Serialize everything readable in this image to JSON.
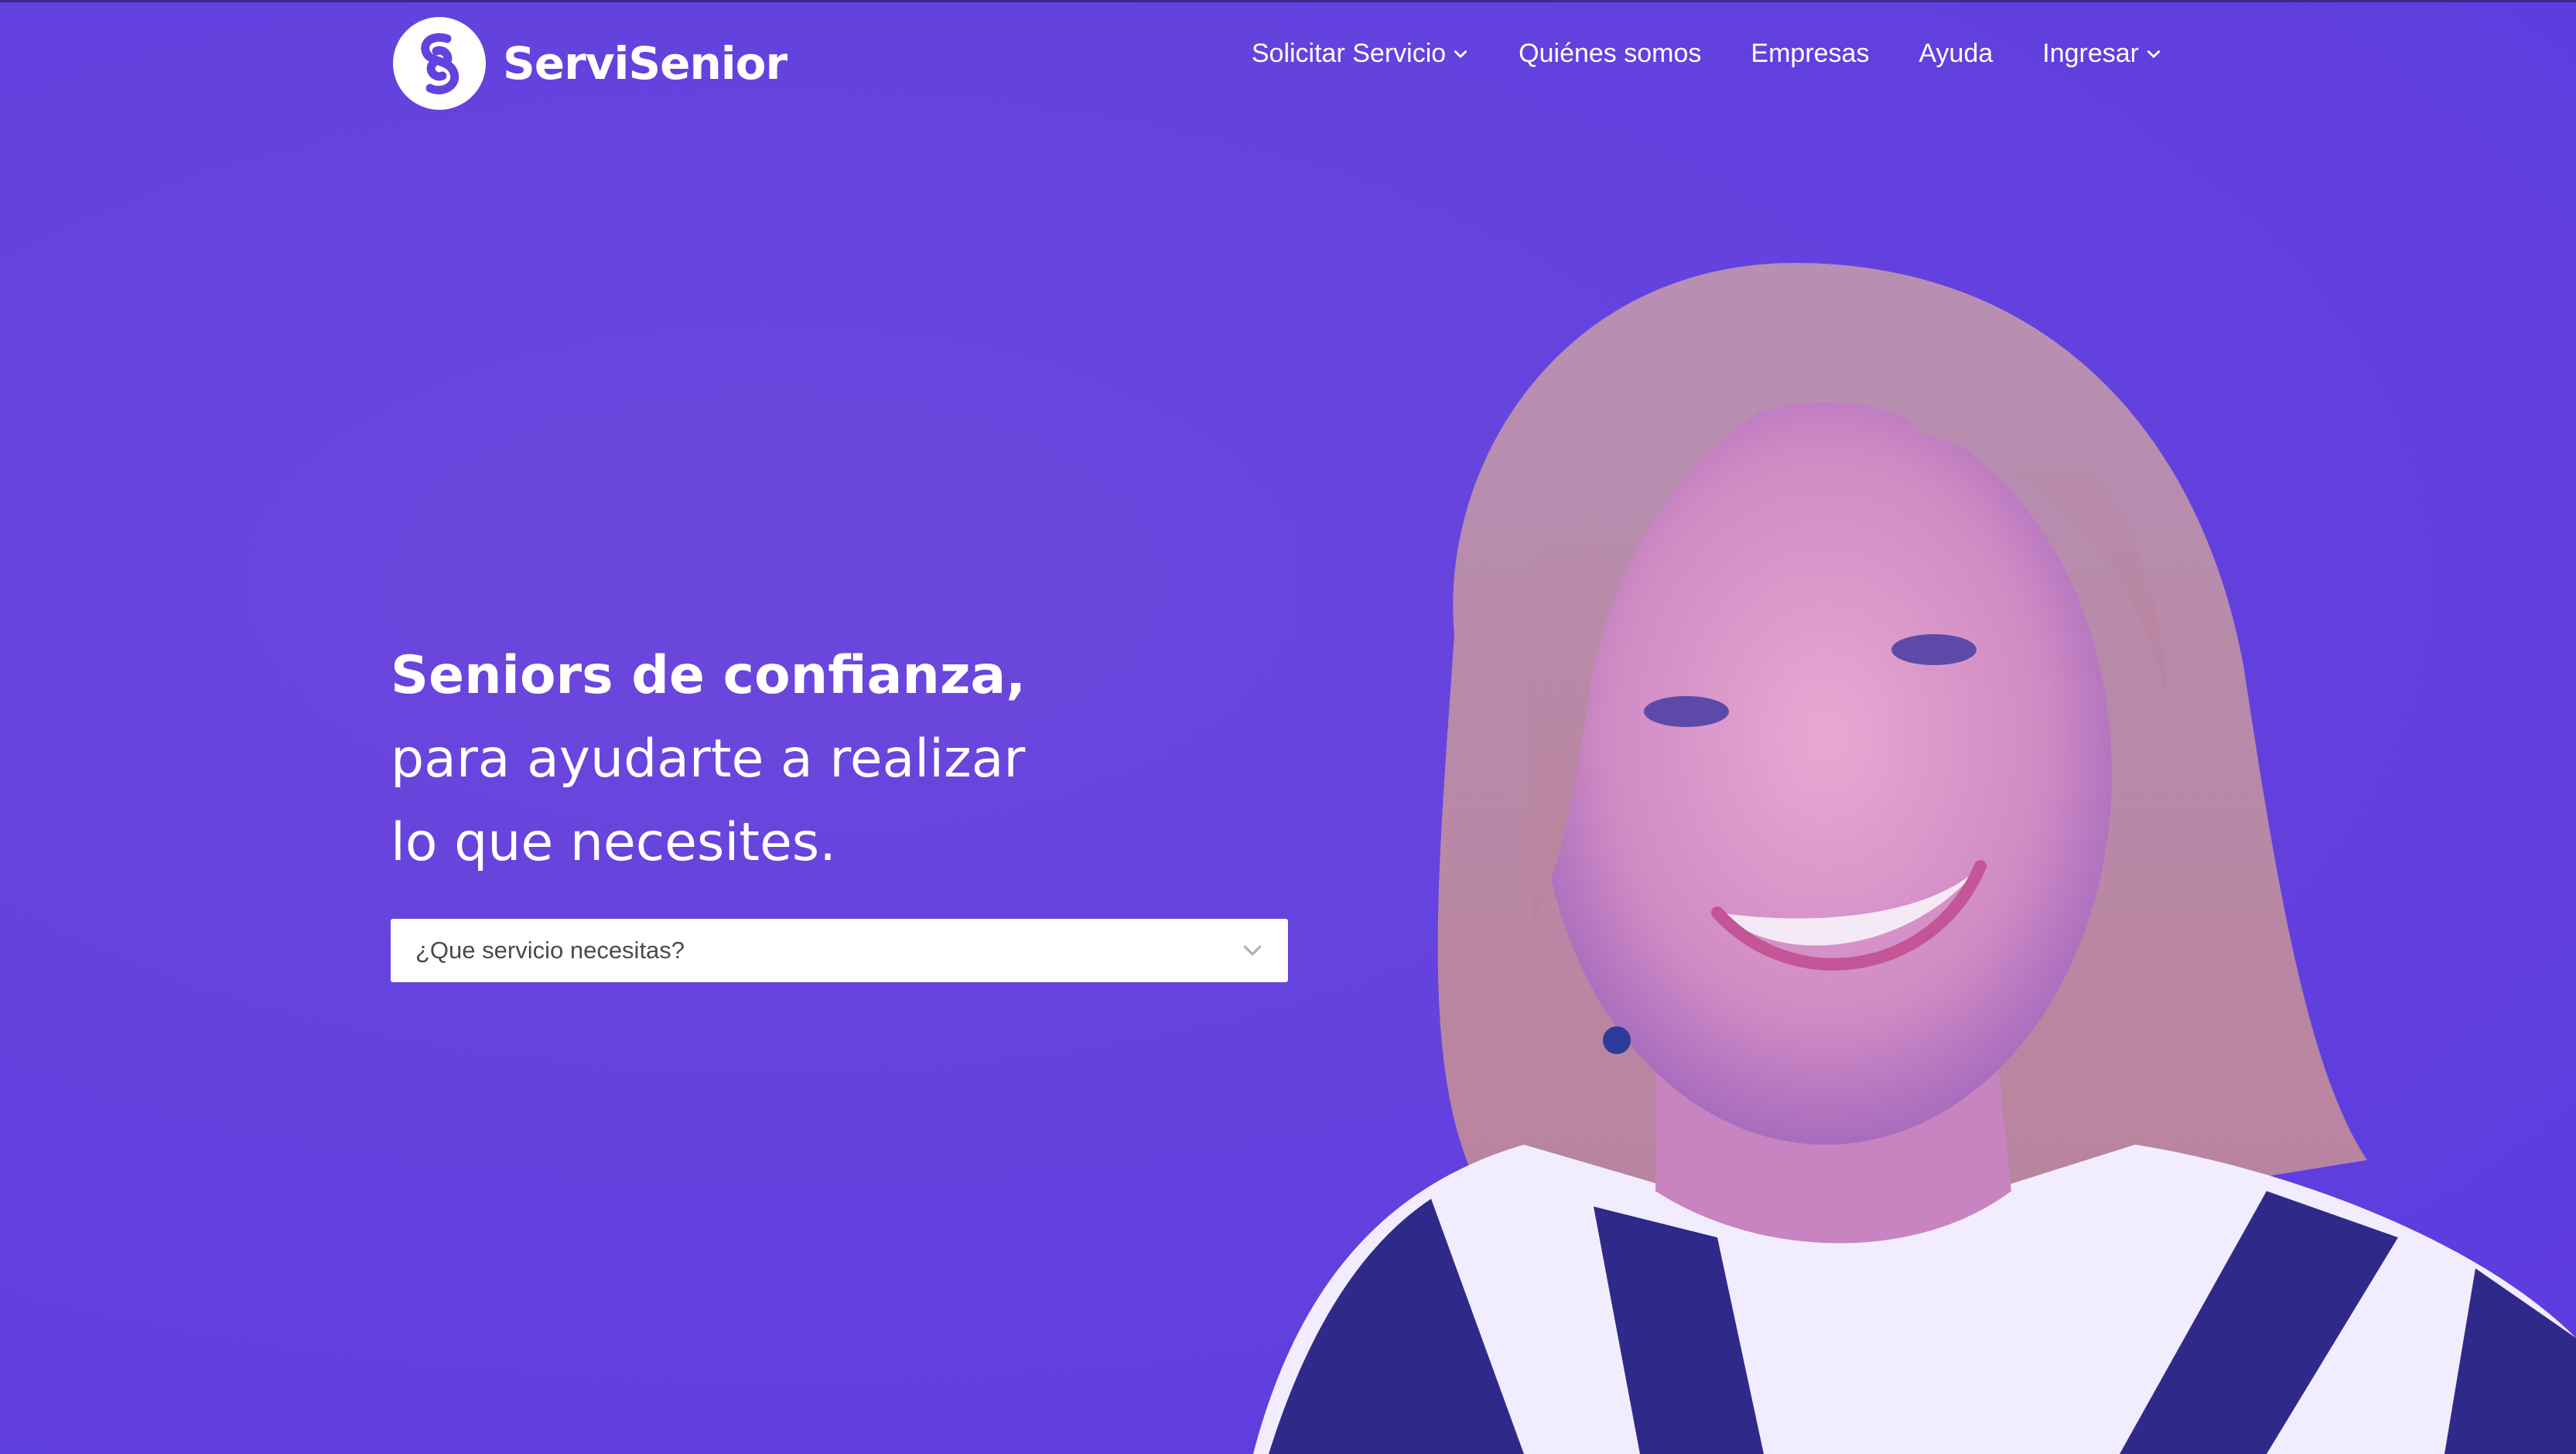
{
  "brand": {
    "name": "ServiSenior"
  },
  "nav": {
    "items": [
      {
        "label": "Solicitar Servicio",
        "has_dropdown": true,
        "icon": "chevron-down-icon"
      },
      {
        "label": "Quiénes somos",
        "has_dropdown": false
      },
      {
        "label": "Empresas",
        "has_dropdown": false
      },
      {
        "label": "Ayuda",
        "has_dropdown": false
      },
      {
        "label": "Ingresar",
        "has_dropdown": true,
        "icon": "chevron-down-icon"
      }
    ]
  },
  "hero": {
    "line1": "Seniors de confianza,",
    "line2": "para ayudarte a realizar",
    "line3": "lo que necesites."
  },
  "service_select": {
    "placeholder": "¿Que servicio necesitas?",
    "icon": "chevron-down-icon"
  },
  "colors": {
    "background": "#6442de",
    "text": "#ffffff",
    "select_bg": "#ffffff",
    "select_text": "#4a4a4a"
  }
}
